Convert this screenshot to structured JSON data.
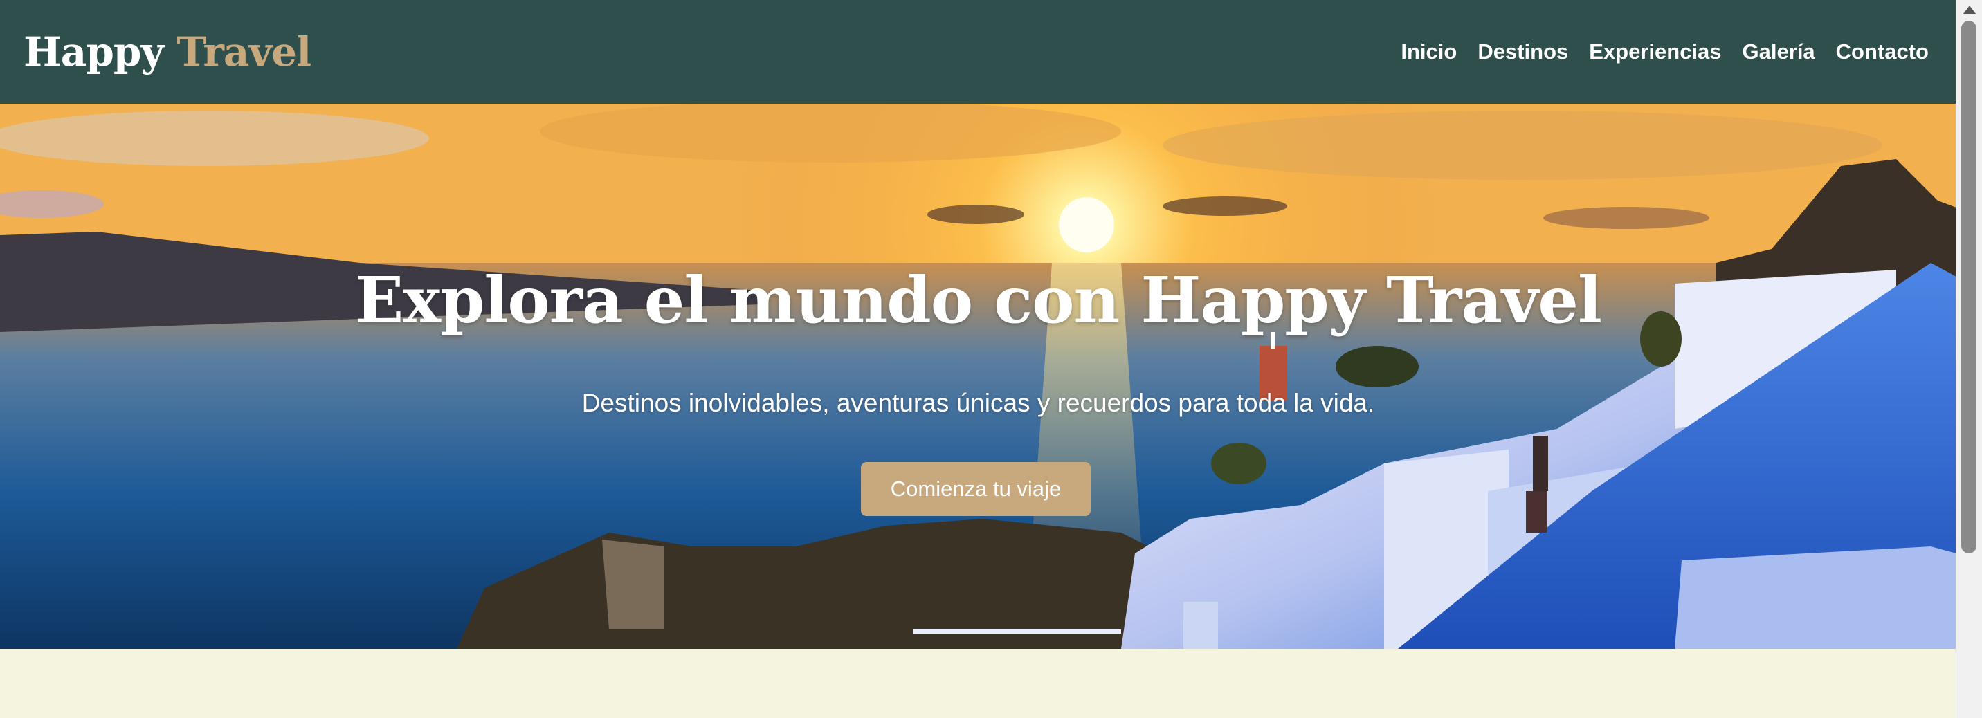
{
  "header": {
    "logo_main": "Happy",
    "logo_accent": "Travel",
    "nav": [
      {
        "label": "Inicio"
      },
      {
        "label": "Destinos"
      },
      {
        "label": "Experiencias"
      },
      {
        "label": "Galería"
      },
      {
        "label": "Contacto"
      }
    ]
  },
  "hero": {
    "title": "Explora el mundo con Happy Travel",
    "subtitle": "Destinos inolvidables, aventuras únicas y recuerdos para toda la vida.",
    "cta_label": "Comienza tu viaje"
  },
  "colors": {
    "header_bg": "#2f4f4d",
    "accent": "#c8a97e",
    "page_bg": "#f5f5df"
  }
}
